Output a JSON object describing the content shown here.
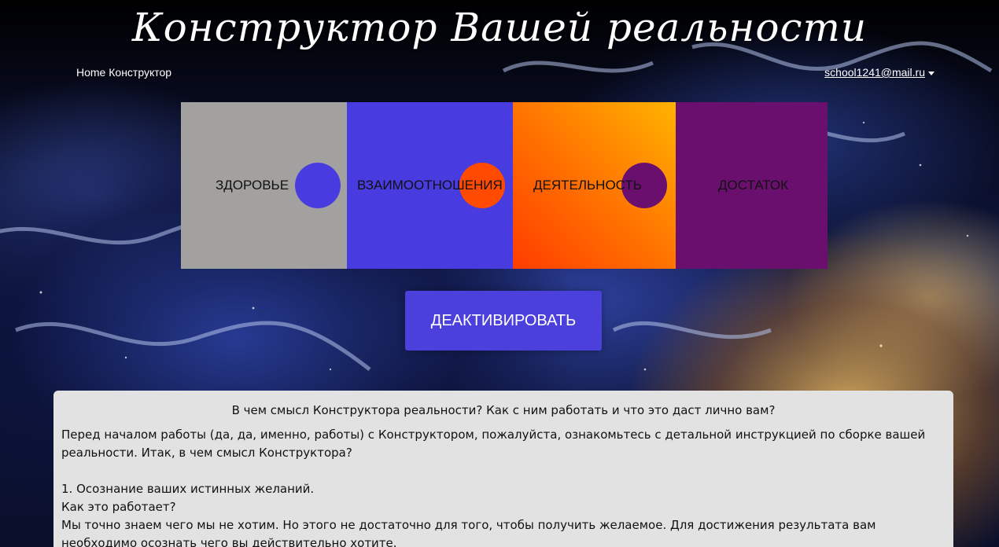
{
  "header": {
    "site_title": "Конструктор Вашей реальности",
    "nav": [
      {
        "label": "Home"
      },
      {
        "label": "Конструктор"
      }
    ],
    "user_email": "school1241@mail.ru"
  },
  "puzzle": {
    "pieces": [
      {
        "label": "ЗДОРОВЬЕ",
        "color": "#a2a1a0"
      },
      {
        "label": "ВЗАИМООТНОШЕНИЯ",
        "color": "#483ce0"
      },
      {
        "label": "ДЕЯТЕЛЬНОСТЬ",
        "color": "#ff7a00"
      },
      {
        "label": "ДОСТАТОК",
        "color": "#6a0f6e"
      }
    ]
  },
  "action_button": {
    "label": "ДЕАКТИВИРОВАТЬ",
    "color": "#4b40dc"
  },
  "info": {
    "heading": "В чем смысл Конструктора реальности? Как с ним работать и что это даст лично вам?",
    "paragraphs": [
      "Перед началом работы (да, да, именно, работы) с Конструктором, пожалуйста, ознакомьтесь с детальной инструкцией по сборке вашей реальности. Итак, в чем смысл Конструктора?",
      "1. Осознание ваших истинных желаний.",
      "Как это работает?",
      "Мы точно знаем чего мы не хотим. Но этого не достаточно для того, чтобы получить желаемое. Для достижения результата вам необходимо осознать чего вы действительно хотите."
    ]
  }
}
